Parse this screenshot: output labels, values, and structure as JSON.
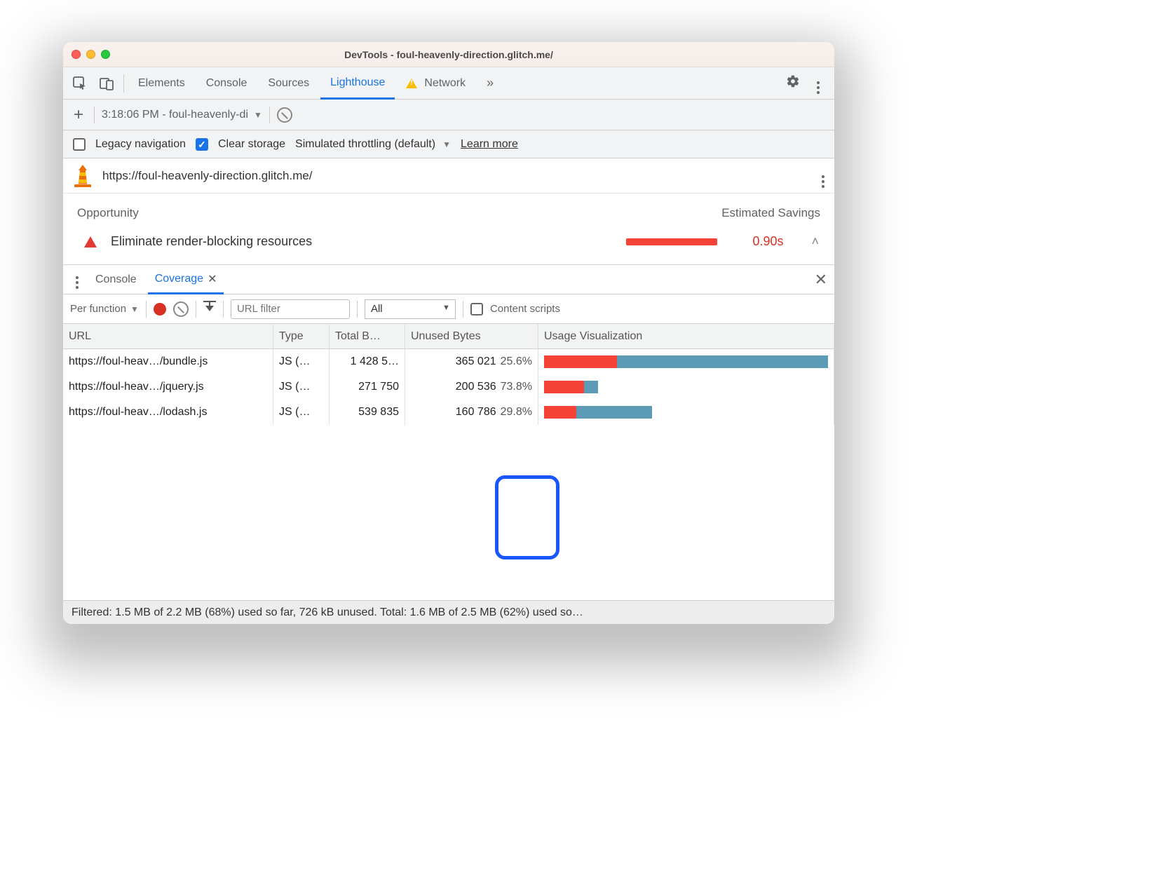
{
  "window": {
    "title": "DevTools - foul-heavenly-direction.glitch.me/"
  },
  "tabs": {
    "items": [
      "Elements",
      "Console",
      "Sources",
      "Lighthouse",
      "Network"
    ],
    "active": "Lighthouse",
    "more_icon": "»"
  },
  "subbar": {
    "report_label": "3:18:06 PM - foul-heavenly-di"
  },
  "options": {
    "legacy_label": "Legacy navigation",
    "legacy_checked": false,
    "clear_label": "Clear storage",
    "clear_checked": true,
    "throttling_label": "Simulated throttling (default)",
    "learn_more": "Learn more"
  },
  "urlbar": {
    "url": "https://foul-heavenly-direction.glitch.me/"
  },
  "opportunity": {
    "header_left": "Opportunity",
    "header_right": "Estimated Savings",
    "title": "Eliminate render-blocking resources",
    "savings": "0.90s"
  },
  "drawer": {
    "tabs": [
      "Console",
      "Coverage"
    ],
    "active": "Coverage"
  },
  "coverage_toolbar": {
    "mode": "Per function",
    "url_filter_placeholder": "URL filter",
    "type_filter": "All",
    "content_scripts_label": "Content scripts",
    "content_scripts_checked": false
  },
  "coverage_table": {
    "columns": {
      "url": "URL",
      "type": "Type",
      "total": "Total B…",
      "unused": "Unused Bytes",
      "viz": "Usage Visualization"
    },
    "rows": [
      {
        "url": "https://foul-heav…/bundle.js",
        "type": "JS (…",
        "total": "1 428 5…",
        "unused_bytes": "365 021",
        "unused_pct": "25.6%",
        "viz_unused": 25.6,
        "viz_used": 74.4,
        "bar_total_frac": 1.0
      },
      {
        "url": "https://foul-heav…/jquery.js",
        "type": "JS (…",
        "total": "271 750",
        "unused_bytes": "200 536",
        "unused_pct": "73.8%",
        "viz_unused": 73.8,
        "viz_used": 26.2,
        "bar_total_frac": 0.19
      },
      {
        "url": "https://foul-heav…/lodash.js",
        "type": "JS (…",
        "total": "539 835",
        "unused_bytes": "160 786",
        "unused_pct": "29.8%",
        "viz_unused": 29.8,
        "viz_used": 70.2,
        "bar_total_frac": 0.38
      }
    ]
  },
  "statusbar": {
    "text": "Filtered: 1.5 MB of 2.2 MB (68%) used so far, 726 kB unused. Total: 1.6 MB of 2.5 MB (62%) used so…"
  }
}
